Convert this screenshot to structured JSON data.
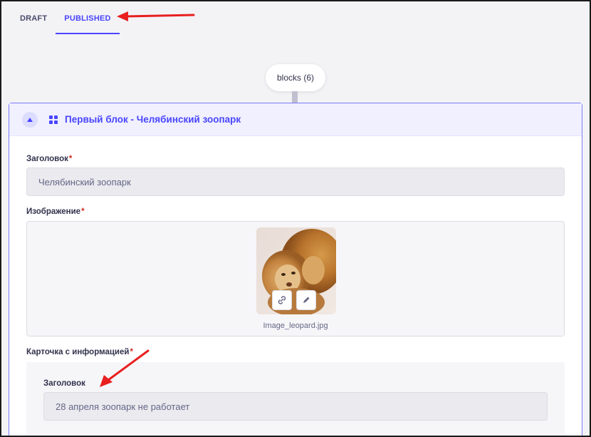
{
  "tabs": [
    {
      "label": "DRAFT",
      "active": false
    },
    {
      "label": "PUBLISHED",
      "active": true
    }
  ],
  "blocks_pill": "blocks (6)",
  "block": {
    "title": "Первый блок - Челябинский зоопарк",
    "collapse_icon": "chevron-up-icon",
    "type_icon": "grid-icon",
    "fields": {
      "title_label": "Заголовок",
      "title_value": "Челябинский зоопарк",
      "image_label": "Изображение",
      "image_filename": "Image_leopard.jpg",
      "card_label": "Карточка с информацией",
      "card_title_label": "Заголовок",
      "card_title_value": "28 апреля зоопарк не работает"
    },
    "required_mark": "*"
  },
  "colors": {
    "primary": "#4945ff",
    "annotation": "#e81f1f",
    "required": "#d02b20"
  }
}
